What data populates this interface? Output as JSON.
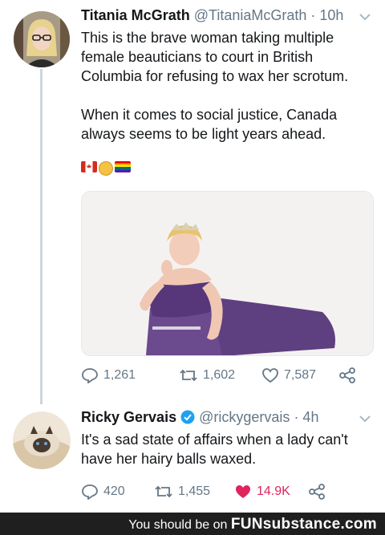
{
  "tweet1": {
    "name": "Titania McGrath",
    "handle": "@TitaniaMcGrath",
    "time": "· 10h",
    "text": "This is the brave woman taking multiple\nfemale beauticians to court in British\nColumbia for refusing to wax her scrotum.\n\nWhen it comes to social justice, Canada\nalways seems to be light years ahead.",
    "emojis": [
      "canada-flag",
      "raised-fist",
      "rainbow-flag"
    ],
    "replies": "1,261",
    "retweets": "1,602",
    "likes": "7,587"
  },
  "tweet2": {
    "name": "Ricky Gervais",
    "handle": "@rickygervais",
    "time": "· 4h",
    "text": "It's a sad state of affairs when a lady can't\nhave her hairy balls waxed.",
    "replies": "420",
    "retweets": "1,455",
    "likes": "14.9K",
    "liked_color": "#e0245e"
  },
  "footer": {
    "prefix": "You should be on",
    "brand": "FUNsubstance.com"
  }
}
